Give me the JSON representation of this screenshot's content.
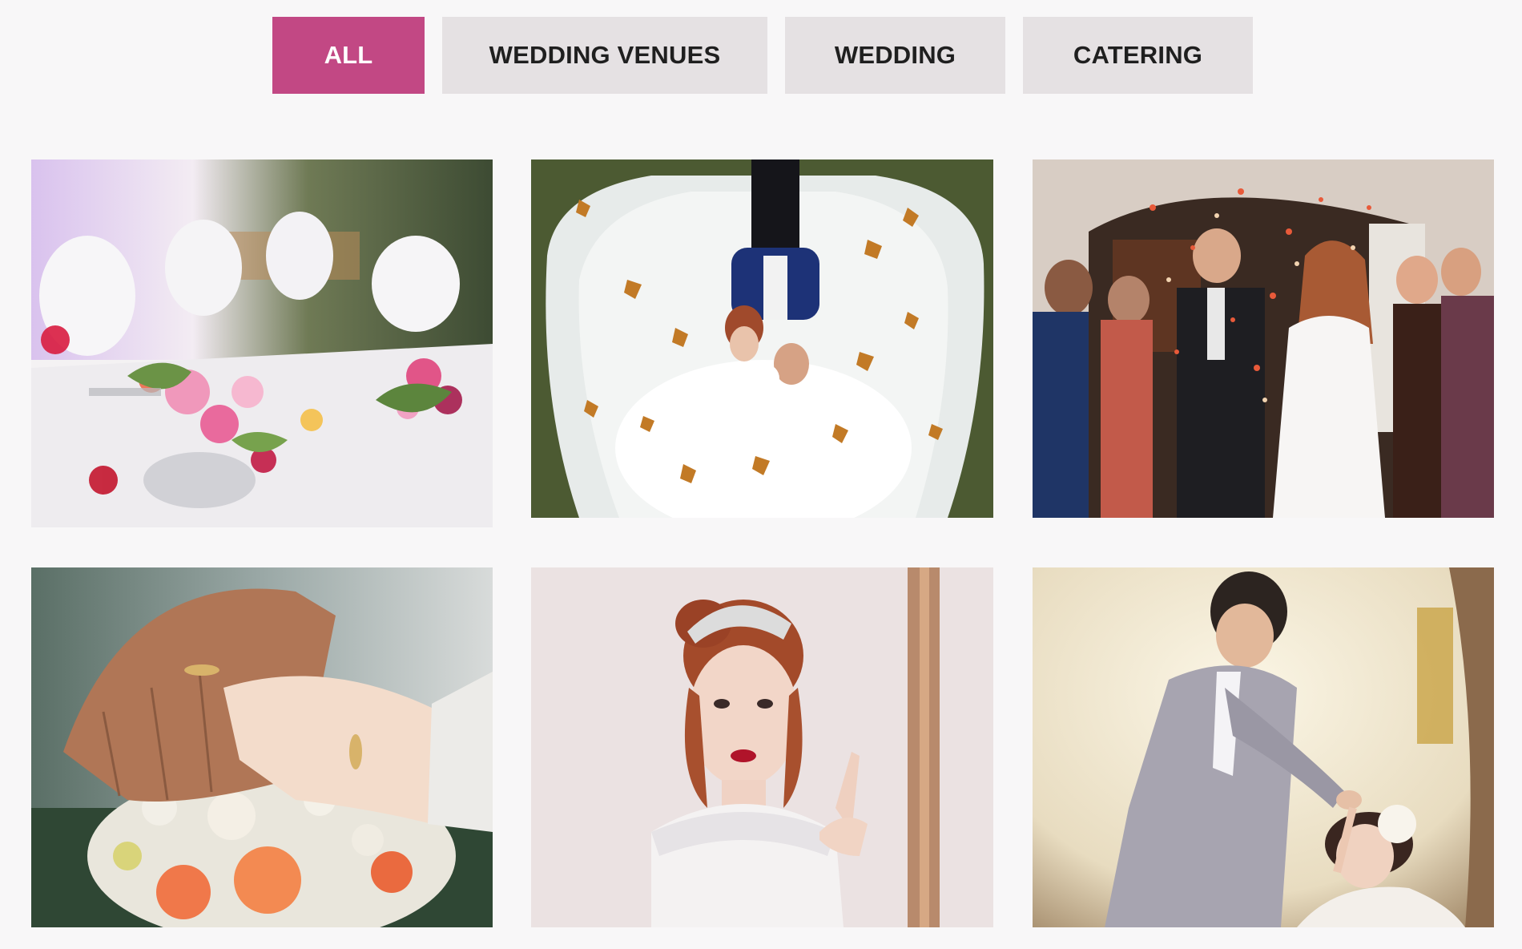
{
  "filters": {
    "all_label": "ALL",
    "venues_label": "WEDDING VENUES",
    "wedding_label": "WEDDING",
    "catering_label": "CATERING",
    "active": "ALL"
  },
  "colors": {
    "accent": "#c24884",
    "tab_background": "#e5e1e3",
    "page_background": "#f8f7f8"
  },
  "gallery": {
    "items": [
      {
        "image": "banquet-table-flowers-photo"
      },
      {
        "image": "couple-lying-on-veil-with-leaves-photo"
      },
      {
        "image": "couple-confetti-exit-photo"
      },
      {
        "image": "hands-with-rings-on-bouquet-photo"
      },
      {
        "image": "bride-with-tiara-portrait-photo"
      },
      {
        "image": "groom-holding-bride-hand-photo"
      }
    ]
  }
}
